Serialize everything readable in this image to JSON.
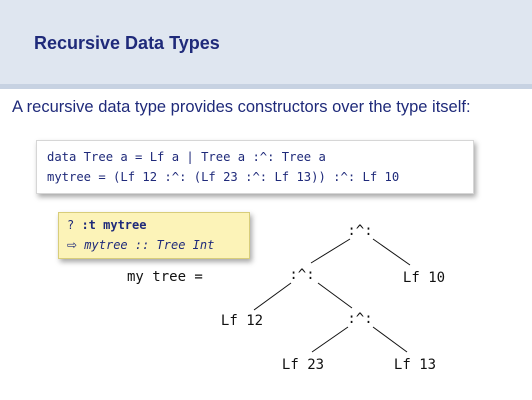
{
  "slide": {
    "title": "Recursive Data Types",
    "intro": "A recursive data type provides constructors over the type itself:"
  },
  "code": {
    "line1": "data Tree a = Lf a | Tree a :^: Tree a",
    "line2": "mytree = (Lf 12 :^: (Lf 23 :^: Lf 13)) :^: Lf 10"
  },
  "ghci": {
    "prompt": "? ",
    "command": ":t mytree",
    "arrow": "⇨",
    "result": "mytree :: Tree Int"
  },
  "tree": {
    "label": "my tree =",
    "nodes": {
      "root": ":^:",
      "left": ":^:",
      "right_leaf": "Lf 10",
      "left_leaf": "Lf 12",
      "inner": ":^:",
      "inner_left": "Lf 23",
      "inner_right": "Lf 13"
    }
  }
}
